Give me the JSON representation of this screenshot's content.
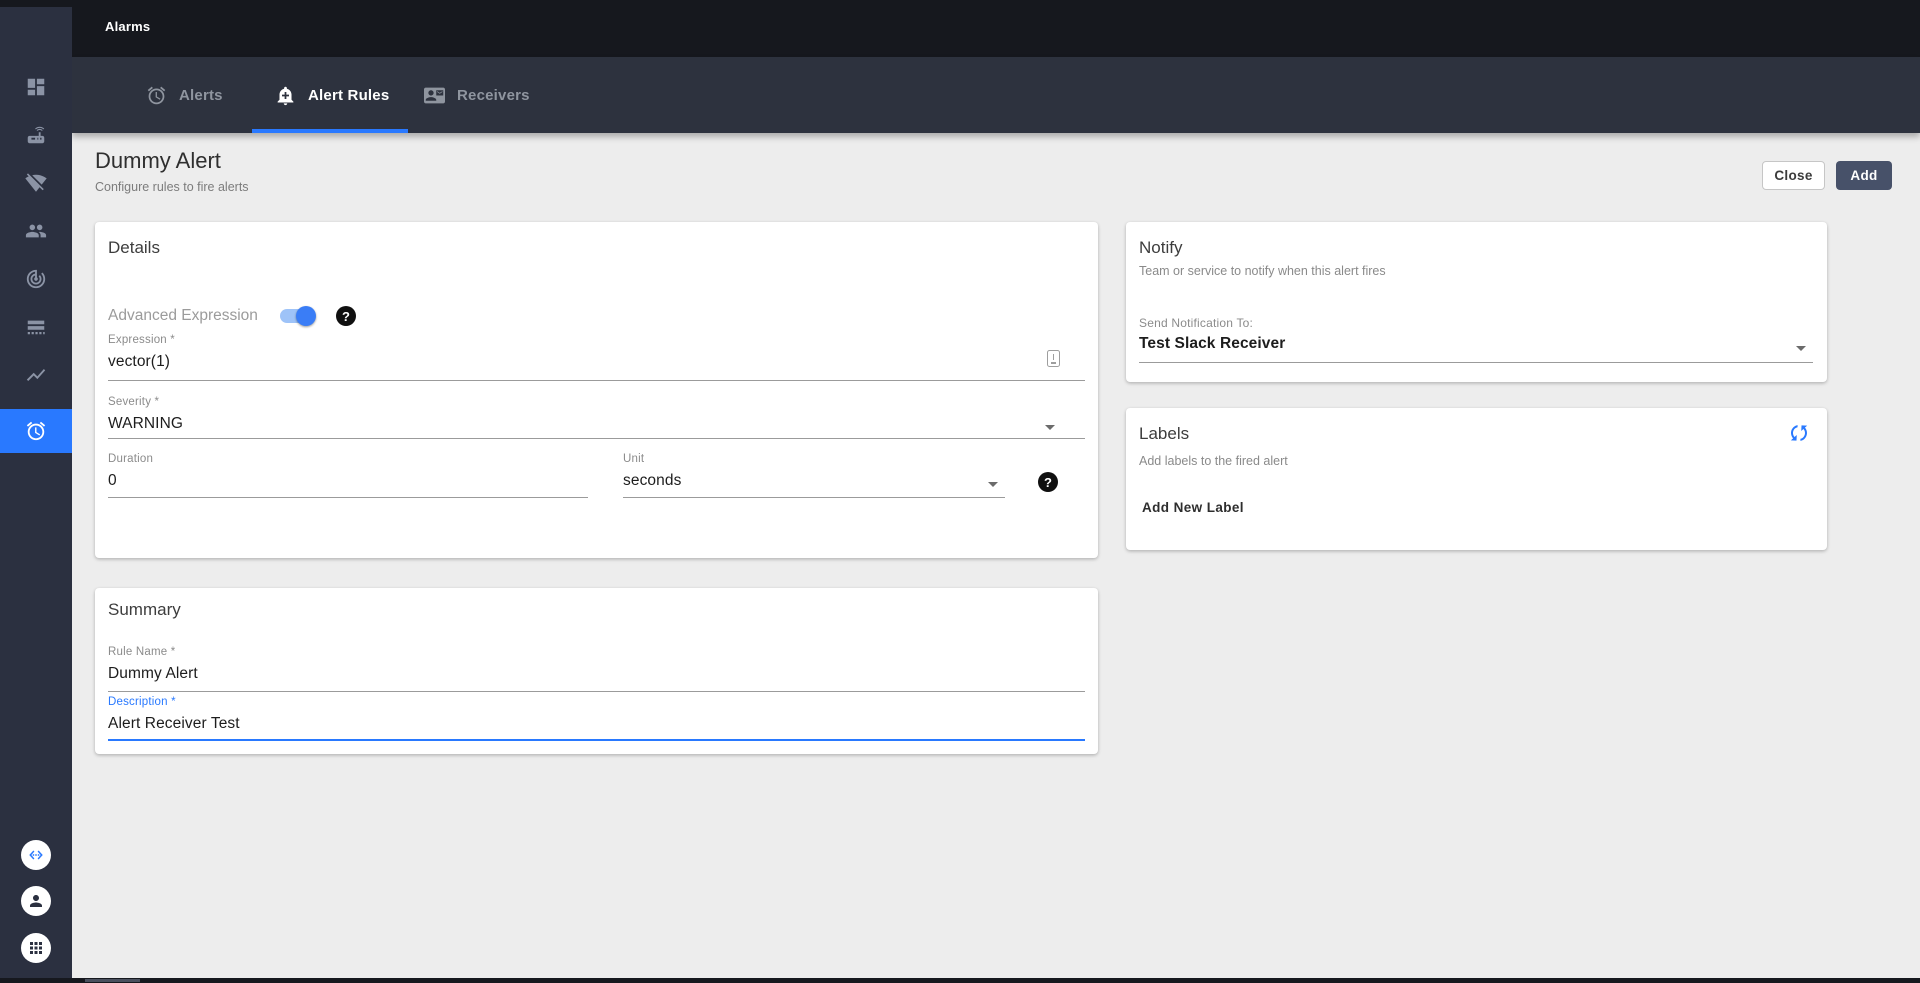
{
  "topbar": {
    "title": "Alarms"
  },
  "tabs": [
    {
      "label": "Alerts",
      "icon": "alarm-clock-icon",
      "active": false
    },
    {
      "label": "Alert Rules",
      "icon": "add-alert-icon",
      "active": true
    },
    {
      "label": "Receivers",
      "icon": "contact-card-icon",
      "active": false
    }
  ],
  "sidebar": {
    "items": [
      {
        "icon": "dashboard-icon",
        "active": false
      },
      {
        "icon": "router-icon",
        "active": false
      },
      {
        "icon": "wifi-off-icon",
        "active": false
      },
      {
        "icon": "users-icon",
        "active": false
      },
      {
        "icon": "track-changes-icon",
        "active": false
      },
      {
        "icon": "storage-icon",
        "active": false
      },
      {
        "icon": "trends-icon",
        "active": false
      },
      {
        "icon": "alarm-icon",
        "active": true
      }
    ],
    "bottom_items": [
      {
        "icon": "code-icon"
      },
      {
        "icon": "account-icon"
      },
      {
        "icon": "apps-grid-icon"
      }
    ]
  },
  "page": {
    "title": "Dummy Alert",
    "subtitle": "Configure rules to fire alerts",
    "close_label": "Close",
    "add_label": "Add"
  },
  "details": {
    "title": "Details",
    "advanced_expression_label": "Advanced Expression",
    "toggle_on": true,
    "fields": {
      "expression": {
        "label": "Expression *",
        "value": "vector(1)"
      },
      "severity": {
        "label": "Severity *",
        "value": "WARNING"
      },
      "duration": {
        "label": "Duration",
        "value": "0"
      },
      "unit": {
        "label": "Unit",
        "value": "seconds"
      }
    }
  },
  "notify": {
    "title": "Notify",
    "subtitle": "Team or service to notify when this alert fires",
    "send_label": "Send Notification To:",
    "receiver_value": "Test Slack Receiver"
  },
  "labels_card": {
    "title": "Labels",
    "subtitle": "Add labels to the fired alert",
    "add_button_label": "Add New Label"
  },
  "summary": {
    "title": "Summary",
    "rule_name": {
      "label": "Rule Name *",
      "value": "Dummy Alert"
    },
    "description": {
      "label": "Description *",
      "value": "Alert Receiver Test"
    }
  },
  "colors": {
    "accent": "#2979ff",
    "sidebar": "#2b3040",
    "topbar": "#16181e",
    "tabbar": "#2d323e",
    "add_button": "#475169",
    "content_bg": "#ededed"
  }
}
